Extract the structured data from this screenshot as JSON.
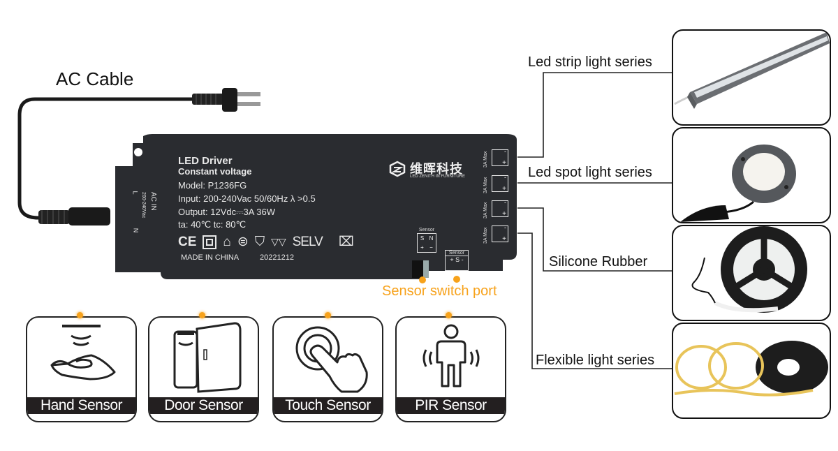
{
  "ac_cable": {
    "label": "AC Cable"
  },
  "driver": {
    "title": "LED  Driver",
    "subtitle": "Constant voltage",
    "model": "Model: P1236FG",
    "input": "Input: 200-240Vac   50/60Hz    λ >0.5",
    "output": "Output: 12Vdc⎓3A   36W",
    "temps": "ta: 40℃   tc: 80℃",
    "made_in": "MADE IN CHINA",
    "date_code": "20221212",
    "certifications": "SELV",
    "ac_in": {
      "label": "AC  IN",
      "range": "200-240Vac",
      "l": "L",
      "n": "N"
    },
    "brand": {
      "name_cn": "维晖科技",
      "name_en": "LED ZENITH IN FURNITURE"
    },
    "output_ports": [
      {
        "rating": "3A Max",
        "minus": "-",
        "plus": "+"
      },
      {
        "rating": "3A Max",
        "minus": "-",
        "plus": "+"
      },
      {
        "rating": "3A Max",
        "minus": "-",
        "plus": "+"
      },
      {
        "rating": "3A Max",
        "minus": "-",
        "plus": "+"
      }
    ],
    "sensor_port_a": {
      "label": "Sensor",
      "pins": [
        "S",
        "N",
        "+",
        "−"
      ]
    },
    "sensor_port_b": {
      "label": "Sensor",
      "pins": "+ S -"
    }
  },
  "sensor_switch_port": {
    "label": "Sensor switch port",
    "color": "#f7a21b"
  },
  "products": [
    {
      "label": "Led strip light series"
    },
    {
      "label": "Led spot light series"
    },
    {
      "label": "Silicone Rubber"
    },
    {
      "label": "Flexible light series"
    }
  ],
  "sensors": [
    {
      "label": "Hand Sensor",
      "icon": "hand-sensor-icon"
    },
    {
      "label": "Door Sensor",
      "icon": "door-sensor-icon"
    },
    {
      "label": "Touch Sensor",
      "icon": "touch-sensor-icon"
    },
    {
      "label": "PIR Sensor",
      "icon": "pir-sensor-icon"
    }
  ]
}
